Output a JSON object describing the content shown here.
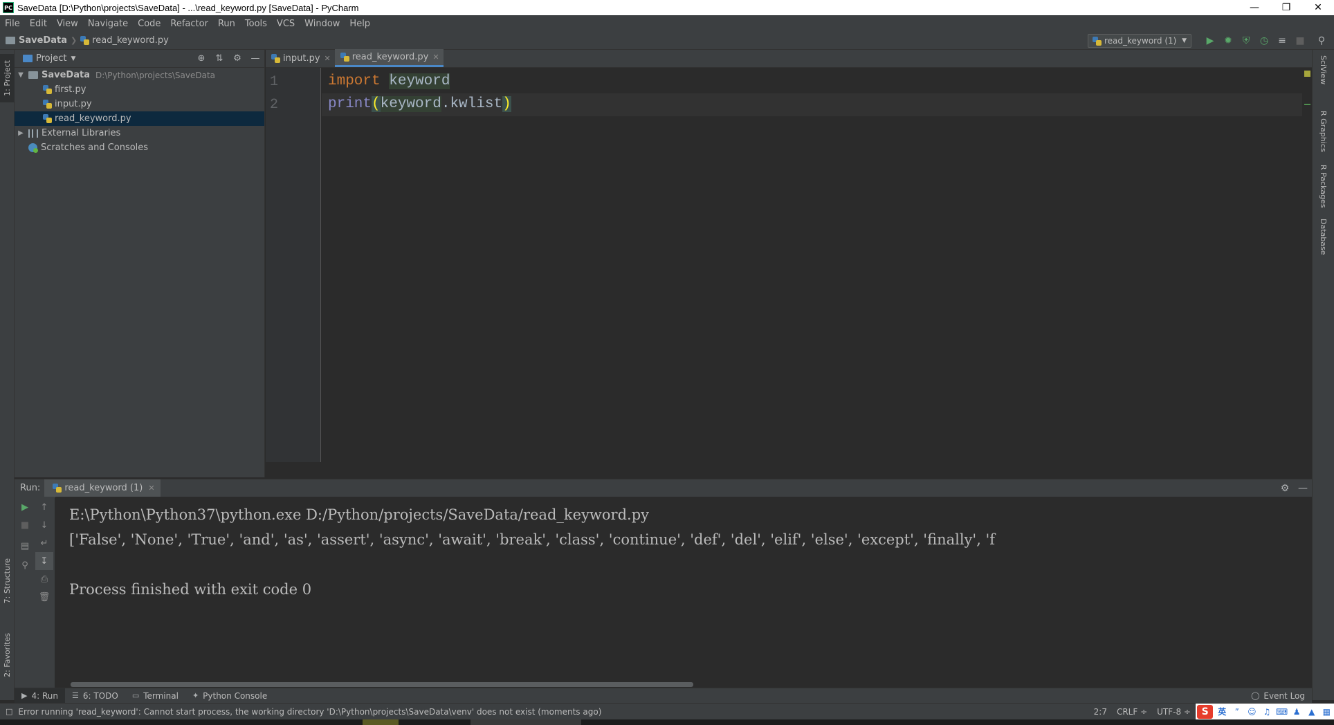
{
  "window": {
    "title": "SaveData [D:\\Python\\projects\\SaveData] - ...\\read_keyword.py [SaveData] - PyCharm",
    "app_icon": "PC",
    "controls": [
      "minimize-icon",
      "restore-icon",
      "close-icon"
    ]
  },
  "menu": [
    "File",
    "Edit",
    "View",
    "Navigate",
    "Code",
    "Refactor",
    "Run",
    "Tools",
    "VCS",
    "Window",
    "Help"
  ],
  "navbar": {
    "project": "SaveData",
    "file": "read_keyword.py",
    "run_config": "read_keyword (1)"
  },
  "left_stripe": {
    "project_tab": "1: Project",
    "structure_tab": "7: Structure",
    "favorites_tab": "2: Favorites"
  },
  "project_panel": {
    "title": "Project",
    "tree": {
      "root_name": "SaveData",
      "root_path": "D:\\Python\\projects\\SaveData",
      "files": [
        "first.py",
        "input.py",
        "read_keyword.py"
      ],
      "external": "External Libraries",
      "scratches": "Scratches and Consoles"
    }
  },
  "editor": {
    "tabs": [
      {
        "label": "input.py",
        "active": false
      },
      {
        "label": "read_keyword.py",
        "active": true
      }
    ],
    "line_numbers": [
      "1",
      "2"
    ],
    "line1": {
      "kw": "import",
      "module": "keyword"
    },
    "line2": {
      "fn": "print",
      "open": "(",
      "obj": "keyword",
      "dot": ".",
      "attr": "kwlist",
      "close": ")"
    }
  },
  "right_stripe": [
    "SciView",
    "R Graphics",
    "R Packages",
    "Database"
  ],
  "run_panel": {
    "label": "Run:",
    "tab": "read_keyword (1)",
    "console": [
      "E:\\Python\\Python37\\python.exe D:/Python/projects/SaveData/read_keyword.py",
      "['False', 'None', 'True', 'and', 'as', 'assert', 'async', 'await', 'break', 'class', 'continue', 'def', 'del', 'elif', 'else', 'except', 'finally', 'f",
      "",
      "Process finished with exit code 0"
    ]
  },
  "bottom_bar": {
    "run": "4: Run",
    "todo": "6: TODO",
    "terminal": "Terminal",
    "python_console": "Python Console",
    "event_log": "Event Log"
  },
  "status": {
    "message": "Error running 'read_keyword': Cannot start process, the working directory 'D:\\Python\\projects\\SaveData\\venv' does not exist (moments ago)",
    "position": "2:7",
    "line_sep": "CRLF ÷",
    "encoding": "UTF-8 ÷",
    "ime_logo": "S",
    "ime_lang": "英"
  },
  "colors": {
    "keyword": "#cc7832",
    "builtin": "#8888c6",
    "identifier": "#a9b7c6",
    "accent": "#4a88c7",
    "selection": "#0d293e",
    "run_green": "#59a869"
  }
}
